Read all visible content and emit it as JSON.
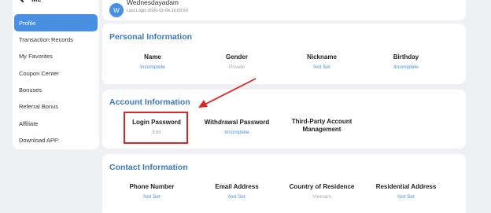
{
  "sidebar": {
    "back_label": "Me",
    "items": [
      {
        "label": "Profile",
        "active": true
      },
      {
        "label": "Transaction Records"
      },
      {
        "label": "My Favorites"
      },
      {
        "label": "Coupon Center"
      },
      {
        "label": "Bonuses"
      },
      {
        "label": "Referral Bonus"
      },
      {
        "label": "Affiliate"
      },
      {
        "label": "Download APP"
      }
    ]
  },
  "user": {
    "avatar_letter": "W",
    "name": "Wednesdayadam",
    "last_login": "Last Login 2026-02-04 16:03:50"
  },
  "personal": {
    "title": "Personal Information",
    "fields": [
      {
        "label": "Name",
        "value": "Incomplete"
      },
      {
        "label": "Gender",
        "value": "Private"
      },
      {
        "label": "Nickname",
        "value": "Not Set"
      },
      {
        "label": "Birthday",
        "value": "Incomplete"
      }
    ]
  },
  "account": {
    "title": "Account Information",
    "fields": [
      {
        "label": "Login Password",
        "value": "Edit"
      },
      {
        "label": "Withdrawal Password",
        "value": "Incomplete"
      },
      {
        "label": "Third-Party Account Management",
        "value": ""
      }
    ]
  },
  "contact": {
    "title": "Contact Information",
    "fields": [
      {
        "label": "Phone Number",
        "value": "Not Set"
      },
      {
        "label": "Email Address",
        "value": "Not Set"
      },
      {
        "label": "Country of Residence",
        "value": "Vietnam"
      },
      {
        "label": "Residential Address",
        "value": "Not Set"
      }
    ]
  },
  "colors": {
    "accent": "#4a90e2",
    "section_title": "#3a78c9",
    "annotation": "#e02424",
    "muted": "#aaaaaa"
  },
  "icons": {
    "back": "chevron-left-icon"
  }
}
